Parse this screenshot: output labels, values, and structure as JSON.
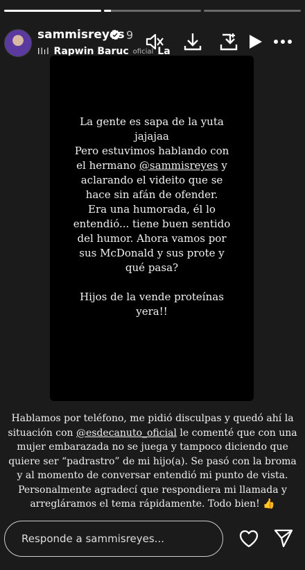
{
  "story": {
    "progress": [
      1,
      0.07,
      0
    ],
    "username": "sammisreyes",
    "time": "9",
    "music": {
      "bars": "Ilıl",
      "track": "Rapwin Baruc",
      "track_suffix": "La",
      "artist_sub": "oficial"
    },
    "card_text_before": "La gente es sapa de la yuta\njajajaa\nPero estuvimos hablando con\nel hermano ",
    "card_mention": "@sammisreyes",
    "card_text_after": " y\naclarando el videito que se\nhace sin afán de ofender.\nEra una humorada, él lo\nentendió... tiene buen sentido\ndel humor. Ahora vamos por\nsus McDonald y sus prote y\nqué pasa?\n\nHijos de la vende proteínas\nyera!!",
    "caption_before": "Hablamos por teléfono, me pidió disculpas y quedó ahí la situación con ",
    "caption_mention": "@esdecanuto_oficial",
    "caption_after": " le comenté que con una mujer embarazada no se juega y tampoco diciendo que quiere ser “padrastro” de mi hijo(a). Se pasó con la broma y al momento de conversar entendió mi punto de vista. Personalmente agradecí que respondiera mi llamada y arregláramos el tema rápidamente. Todo bien! 👍"
  },
  "reply": {
    "placeholder": "Responde a sammisreyes..."
  },
  "icons": {
    "verified": "verified-badge-icon",
    "mute": "speaker-muted-icon",
    "download": "download-icon",
    "save": "save-to-device-icon",
    "play": "play-icon",
    "more": "more-horizontal-icon",
    "heart": "heart-icon",
    "send": "send-icon"
  }
}
